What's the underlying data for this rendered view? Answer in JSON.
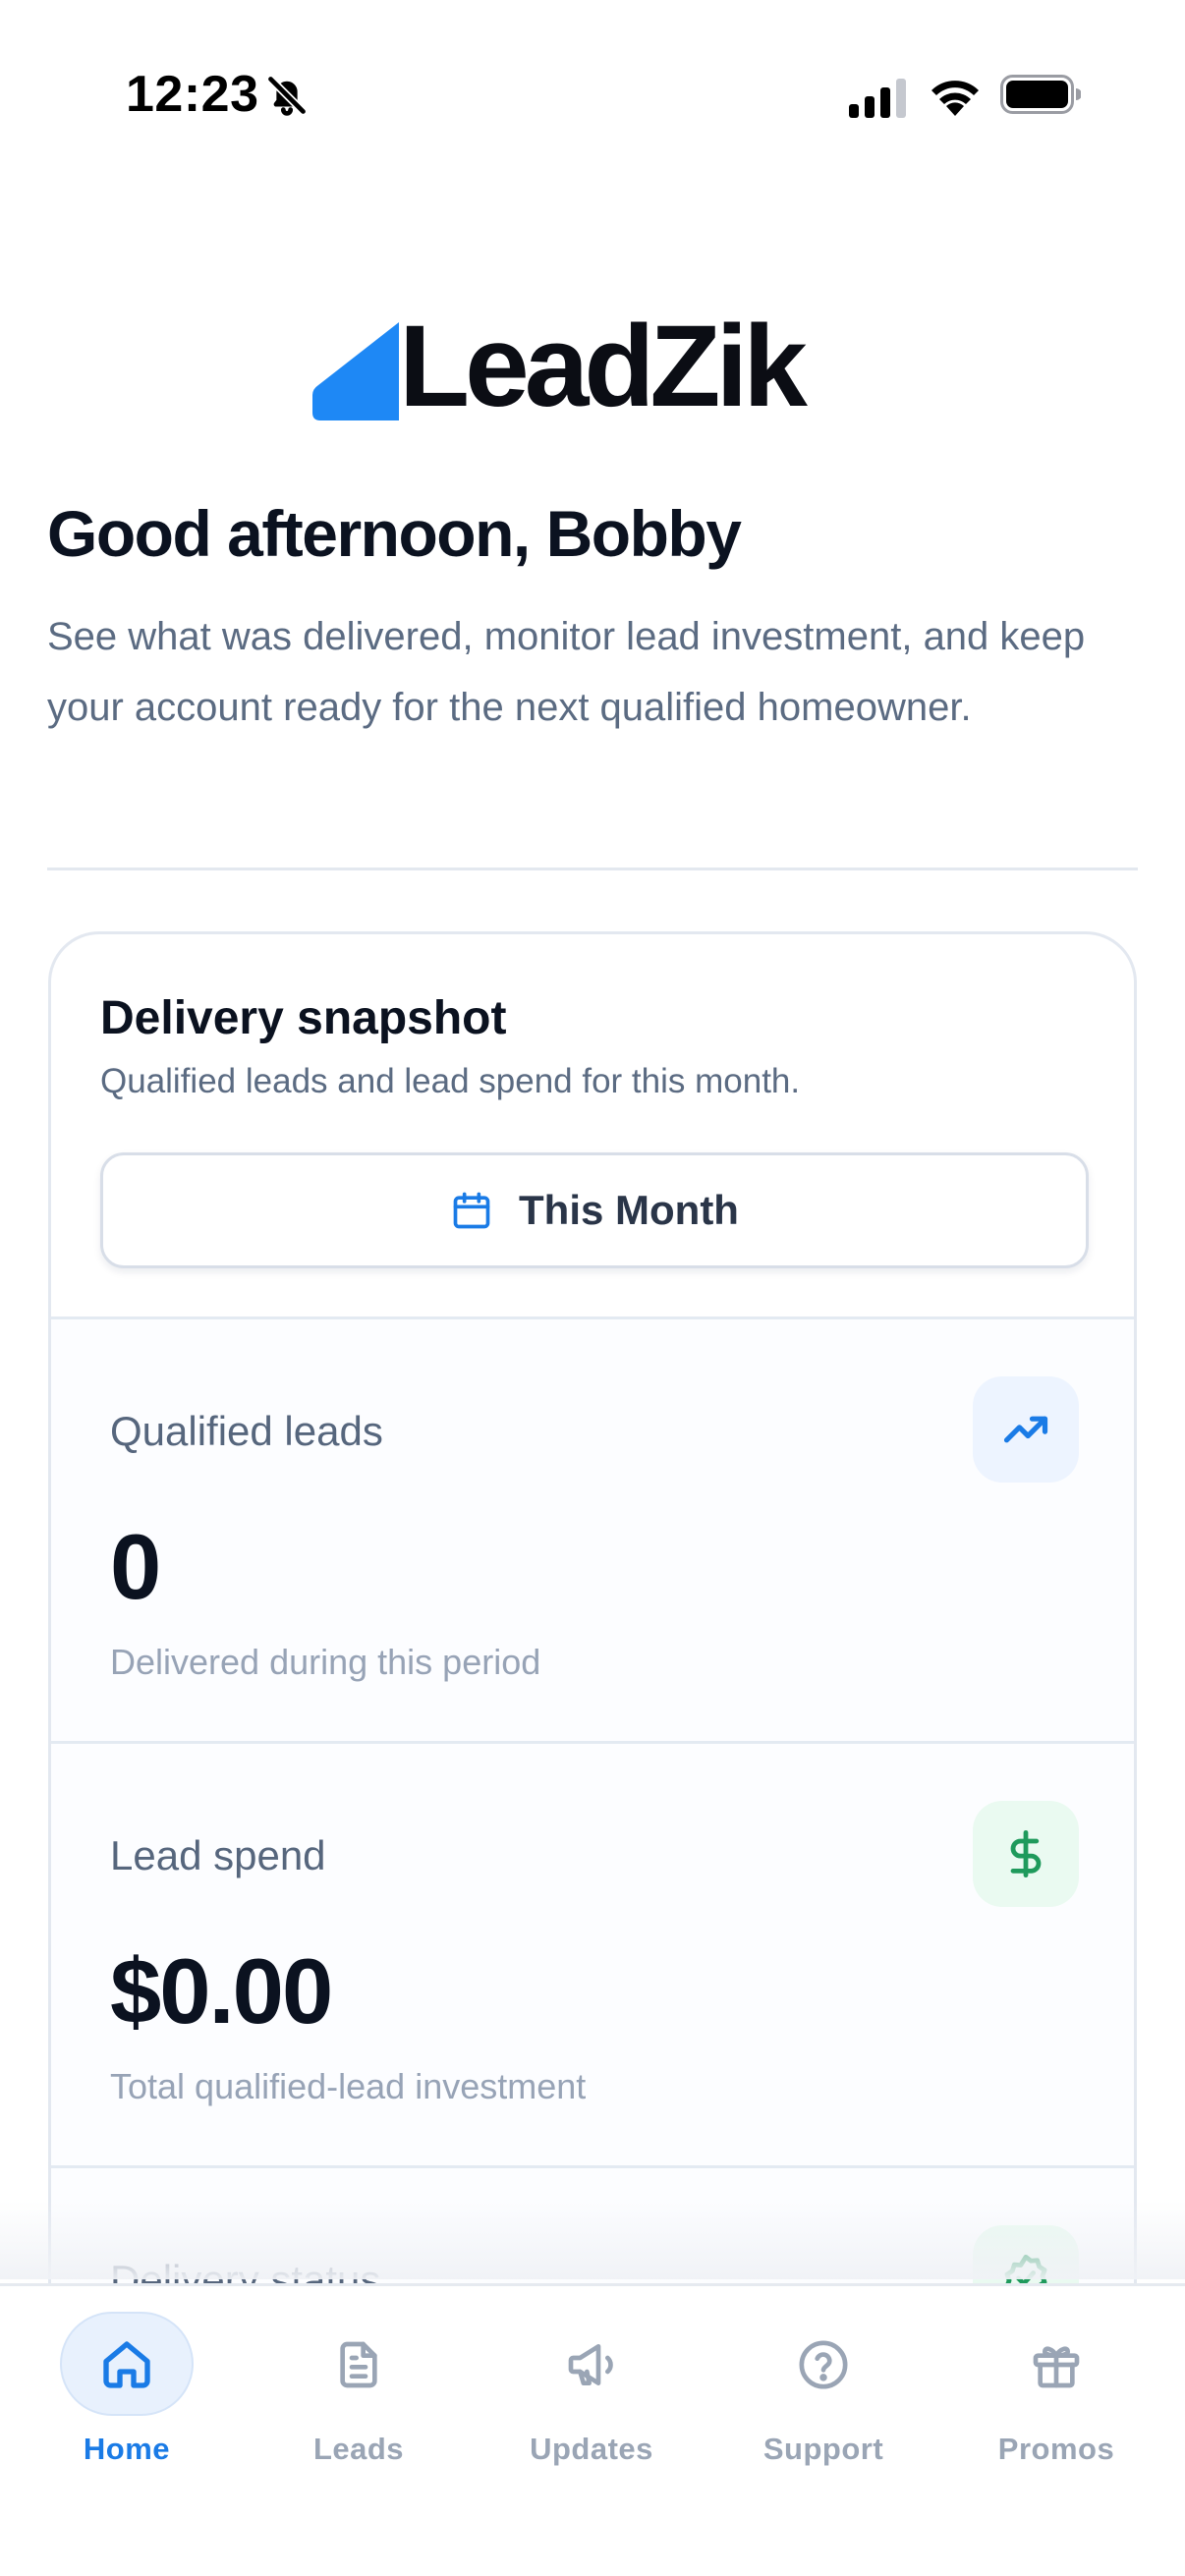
{
  "status_bar": {
    "time": "12:23",
    "icons": [
      "bell-slash-icon",
      "cellular-signal-icon",
      "wifi-icon",
      "battery-icon"
    ]
  },
  "brand": {
    "name": "LeadZik",
    "accent_color": "#1e88f5"
  },
  "greeting": "Good afternoon, Bobby",
  "intro": "See what was delivered, monitor lead investment, and keep your account ready for the next qualified homeowner.",
  "snapshot": {
    "title": "Delivery snapshot",
    "subtitle": "Qualified leads and lead spend for this month.",
    "period_button": {
      "label": "This Month",
      "icon": "calendar-icon"
    },
    "metrics": [
      {
        "label": "Qualified leads",
        "value": "0",
        "note": "Delivered during this period",
        "icon": "trending-up-icon",
        "icon_color": "#1a7be6"
      },
      {
        "label": "Lead spend",
        "value": "$0.00",
        "note": "Total qualified-lead investment",
        "icon": "dollar-icon",
        "icon_color": "#1f9a5c"
      },
      {
        "label": "Delivery status",
        "icon": "badge-check-icon",
        "icon_color": "#1f9a5c"
      }
    ]
  },
  "bottom_nav": {
    "active_color": "#1a7be6",
    "inactive_color": "#9aa5b5",
    "items": [
      {
        "label": "Home",
        "icon": "home-icon",
        "active": true
      },
      {
        "label": "Leads",
        "icon": "document-icon",
        "active": false
      },
      {
        "label": "Updates",
        "icon": "megaphone-icon",
        "active": false
      },
      {
        "label": "Support",
        "icon": "help-circle-icon",
        "active": false
      },
      {
        "label": "Promos",
        "icon": "gift-icon",
        "active": false
      }
    ]
  }
}
